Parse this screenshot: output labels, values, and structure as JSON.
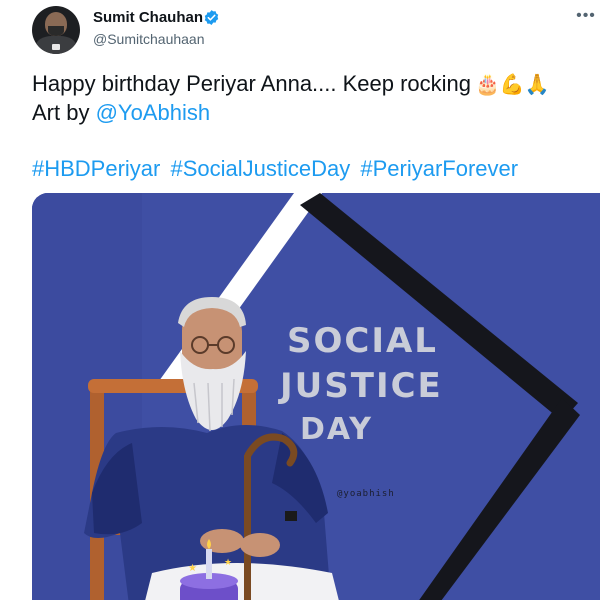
{
  "author": {
    "display_name": "Sumit Chauhan",
    "handle": "@Sumitchauhaan",
    "verified": true
  },
  "tweet": {
    "line1_text": "Happy birthday Periyar Anna.... Keep rocking",
    "line1_emojis": "🎂💪🙏",
    "line2_prefix": "Art by ",
    "line2_mention": "@YoAbhish",
    "hashtags": [
      "#HBDPeriyar",
      "#SocialJusticeDay",
      "#PeriyarForever"
    ]
  },
  "more_icon": "more-options-icon",
  "media": {
    "poster_lines": [
      "SOCIAL",
      "JUSTICE",
      "DAY"
    ],
    "signature": "@yoabhish",
    "colors": {
      "background": "#3f4fa4",
      "frame_white": "#ffffff",
      "frame_black": "#15161c",
      "text": "#c9ccd8"
    }
  },
  "colors": {
    "link": "#1d9bf0",
    "text": "#0f1419",
    "secondary": "#536471",
    "verified": "#1d9bf0"
  }
}
